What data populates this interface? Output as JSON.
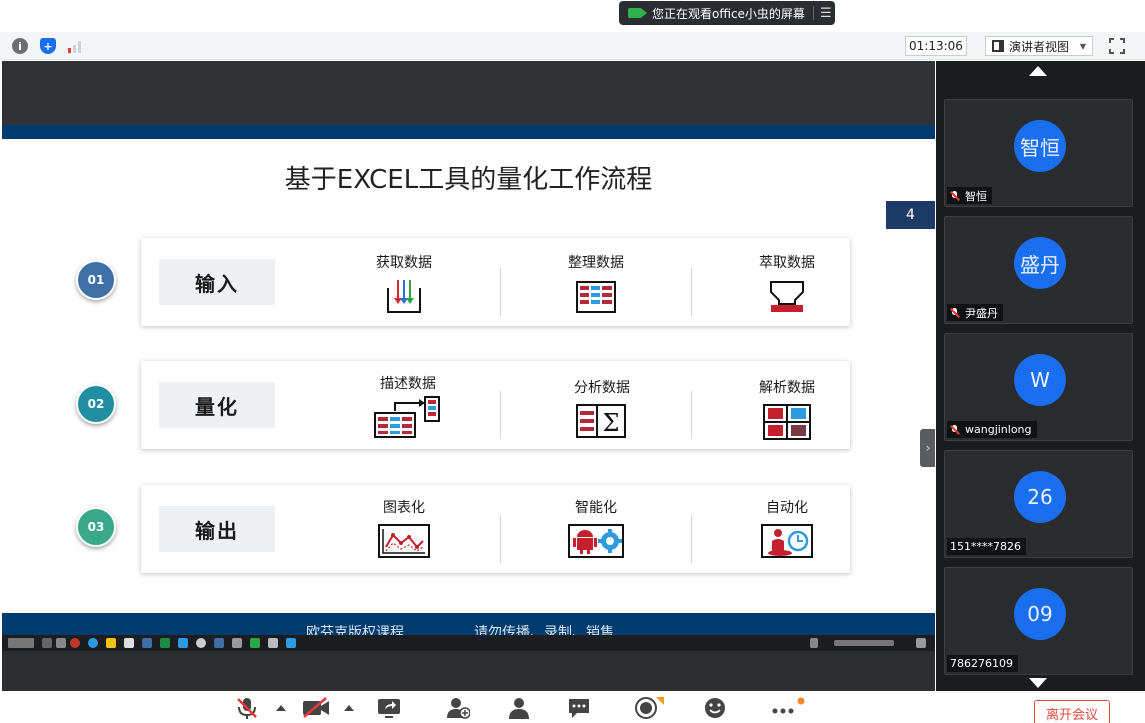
{
  "banner": {
    "text": "您正在观看office小虫的屏幕",
    "menu_icon": "list-icon"
  },
  "toolbar": {
    "timer": "01:13:06",
    "view_label": "演讲者视图",
    "icons": [
      "info-icon",
      "shield-icon",
      "signal-icon",
      "fullscreen-icon"
    ]
  },
  "slide": {
    "title": "基于EXCEL工具的量化工作流程",
    "page_number": "4",
    "rows": [
      {
        "num": "01",
        "color": "#3f6fa6",
        "label": "输入",
        "items": [
          {
            "label": "获取数据",
            "icon": "import-arrows-icon"
          },
          {
            "label": "整理数据",
            "icon": "table-icon"
          },
          {
            "label": "萃取数据",
            "icon": "extract-icon"
          }
        ]
      },
      {
        "num": "02",
        "color": "#1f8ea1",
        "label": "量化",
        "items": [
          {
            "label": "描述数据",
            "icon": "describe-icon"
          },
          {
            "label": "分析数据",
            "icon": "sigma-icon"
          },
          {
            "label": "解析数据",
            "icon": "grid-icon"
          }
        ]
      },
      {
        "num": "03",
        "color": "#3aa88a",
        "label": "输出",
        "items": [
          {
            "label": "图表化",
            "icon": "chart-icon"
          },
          {
            "label": "智能化",
            "icon": "android-gear-icon"
          },
          {
            "label": "自动化",
            "icon": "clock-person-icon"
          }
        ]
      }
    ],
    "footer_left": "欧芬克版权课程",
    "footer_right": "请勿传播、录制、销售"
  },
  "participants": [
    {
      "avatar": "智恒",
      "name": "智恒"
    },
    {
      "avatar": "盛丹",
      "name": "尹盛丹"
    },
    {
      "avatar": "W",
      "name": "wangjinlong"
    },
    {
      "avatar": "26",
      "name": "151****7826"
    },
    {
      "avatar": "09",
      "name": "786276109"
    }
  ],
  "controls": {
    "leave_label": "离开会议",
    "icons": [
      "mic-muted-icon",
      "camera-off-icon",
      "share-screen-icon",
      "invite-icon",
      "members-icon",
      "chat-icon",
      "record-icon",
      "emoji-icon",
      "more-icon"
    ]
  },
  "colors": {
    "slide_blue": "#003b6f",
    "accent_blue": "#1a6ff0",
    "leave_red": "#e04b3f"
  }
}
